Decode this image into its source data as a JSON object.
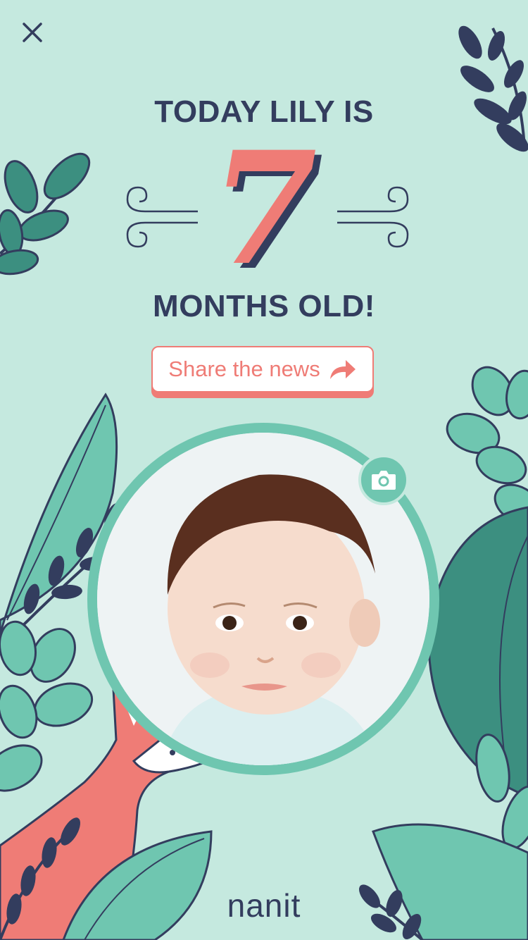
{
  "header": {
    "line1": "TODAY LILY IS",
    "age_number": "7",
    "line2": "MONTHS OLD!"
  },
  "share": {
    "label": "Share the news"
  },
  "brand": {
    "logo_text": "nanit"
  },
  "icons": {
    "close": "close-icon",
    "share": "share-arrow-icon",
    "camera": "camera-icon"
  },
  "colors": {
    "background": "#c5e9df",
    "navy": "#333d5e",
    "coral": "#ef7c76",
    "teal": "#6fc6b0",
    "dark_teal": "#3c8f80"
  }
}
